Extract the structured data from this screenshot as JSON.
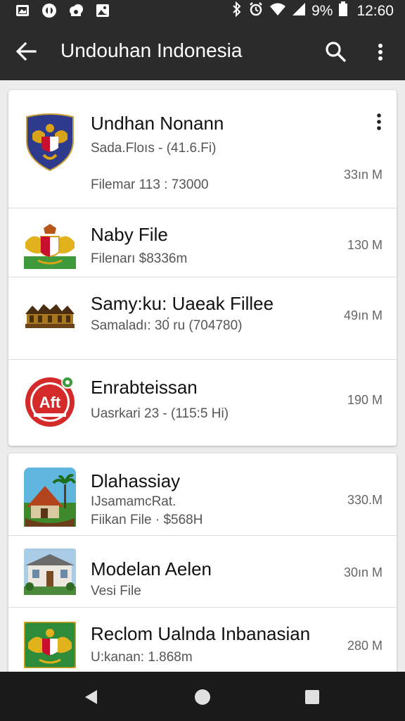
{
  "status_bar": {
    "icons_left": [
      "gallery-icon",
      "circle-app-icon",
      "cloud-icon",
      "photo-icon"
    ],
    "battery_text": "9%",
    "time": "12:60"
  },
  "app_bar": {
    "title": "Undouhan Indonesia"
  },
  "files": [
    {
      "name": "Undhan Nonann",
      "sub1": "Sada.Floıs - (41.6.Fi)",
      "sub2": "Filemar 113 : 73000",
      "size": "33ın M",
      "icon": "garuda-shield-icon"
    },
    {
      "name": "Naby File",
      "sub1": "Filenarı $8336m",
      "size": "130 M",
      "icon": "garuda-emblem-icon"
    },
    {
      "name": "Samy:ku: Uaeak Fillee",
      "sub1": "Samaladı: 30́ ru (704780)",
      "size": "49ın M",
      "icon": "traditional-house-icon"
    },
    {
      "name": "Enrabteissan",
      "sub1": "Uasrkari 23 - (115:5 Hi)",
      "size": "190 M",
      "icon": "aft-badge-icon"
    },
    {
      "name": "Dlahassiay",
      "sub1": "IJsamamcRat.",
      "sub2": "Fiikan File · $568H",
      "size": "330.M",
      "icon": "beach-house-icon"
    },
    {
      "name": "Modelan Aelen",
      "sub1": "Vesi File",
      "size": "30ın M",
      "icon": "house-photo-icon"
    },
    {
      "name": "Reclom Ualnda Inbanasian",
      "sub1": "U:kanan: 1.868m",
      "size": "280 M",
      "icon": "garuda-green-icon"
    }
  ],
  "aft_badge_text": "Aft",
  "colors": {
    "bar": "#2b2b2b",
    "nav": "#1a1a1a",
    "garuda_gold": "#d9a21b",
    "shield_red": "#c8102e",
    "navy": "#2e3a8c",
    "aft_red": "#d42a2a",
    "green": "#2e8b3a"
  }
}
